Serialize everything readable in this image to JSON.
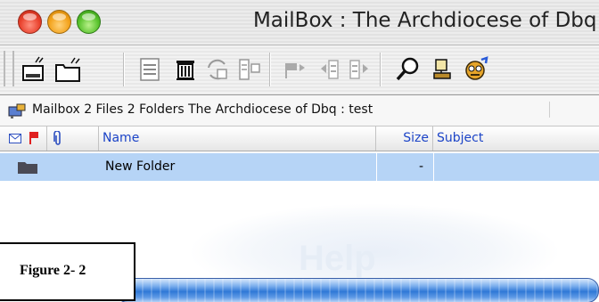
{
  "window": {
    "title": "MailBox : The Archdiocese of Dbq : test"
  },
  "toolbar": {
    "buttons": [
      {
        "icon": "new-message-icon"
      },
      {
        "icon": "new-folder-icon"
      },
      {
        "icon": "archive-icon"
      },
      {
        "icon": "delete-icon"
      },
      {
        "icon": "sync-icon"
      },
      {
        "icon": "properties-icon"
      },
      {
        "icon": "flag-icon"
      },
      {
        "icon": "move-left-icon"
      },
      {
        "icon": "move-right-icon"
      },
      {
        "icon": "search-icon"
      },
      {
        "icon": "user-icon"
      },
      {
        "icon": "robot-icon"
      }
    ]
  },
  "pathbar": {
    "text": "Mailbox  2 Files 2 Folders  The Archdiocese of Dbq : test"
  },
  "columns": {
    "name": "Name",
    "size": "Size",
    "subject": "Subject"
  },
  "rows": [
    {
      "name": "New Folder",
      "size": "-",
      "subject": ""
    }
  ],
  "watermark": {
    "text": "Help"
  },
  "figure": {
    "label": "Figure 2- 2"
  },
  "colors": {
    "selection": "#b6d4f6",
    "header_text": "#1c44c7",
    "progress": "#2f78d6"
  }
}
